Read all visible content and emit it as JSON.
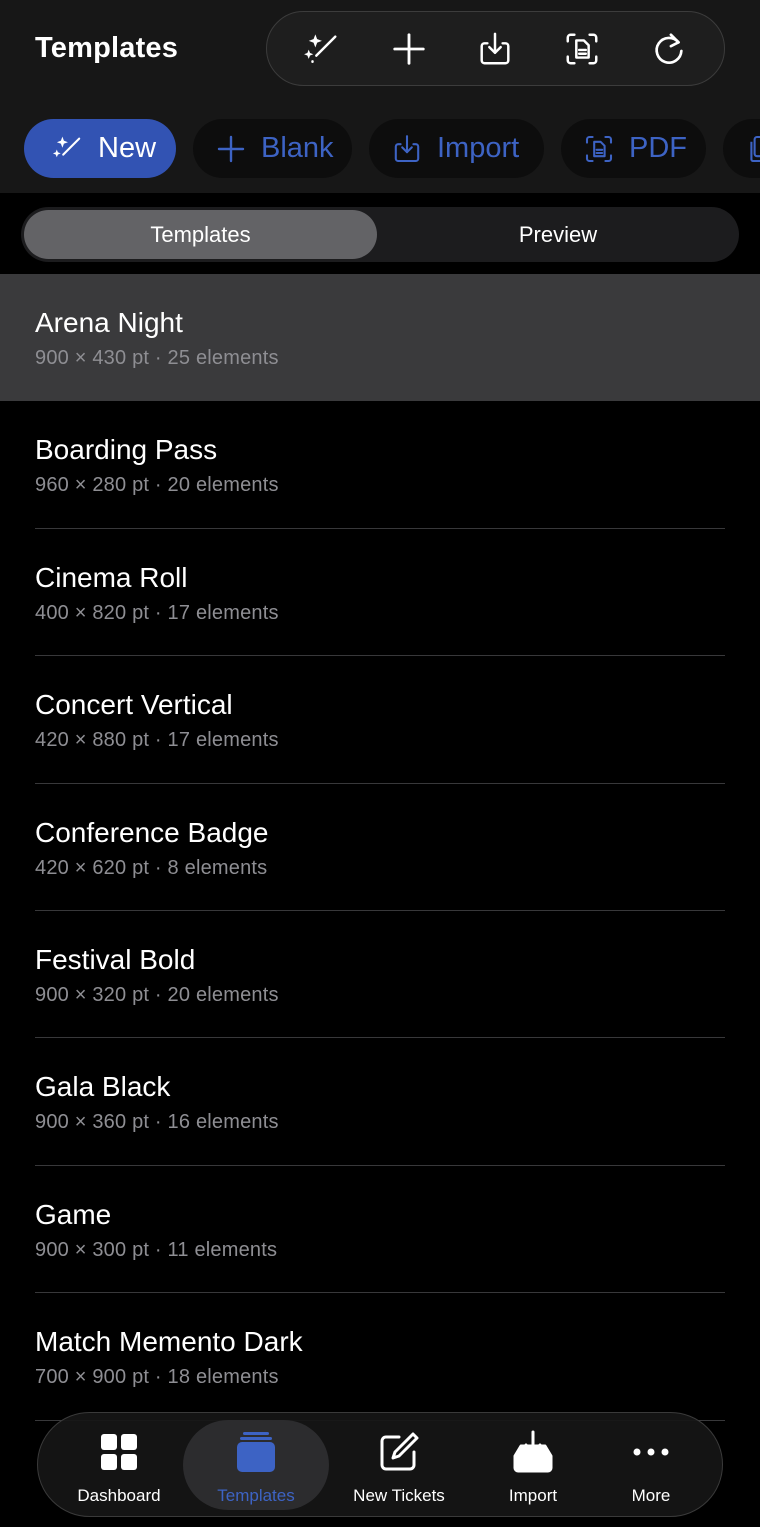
{
  "header": {
    "title": "Templates",
    "toolbar": [
      {
        "icon": "magic-wand-icon"
      },
      {
        "icon": "plus-icon"
      },
      {
        "icon": "import-tray-icon"
      },
      {
        "icon": "scan-document-icon"
      },
      {
        "icon": "refresh-icon"
      }
    ]
  },
  "chips": [
    {
      "label": "New",
      "icon": "magic-wand-icon"
    },
    {
      "label": "Blank",
      "icon": "plus-icon"
    },
    {
      "label": "Import",
      "icon": "import-tray-icon"
    },
    {
      "label": "PDF",
      "icon": "scan-document-icon"
    }
  ],
  "segment": {
    "templates_label": "Templates",
    "preview_label": "Preview",
    "selected": "Templates"
  },
  "templates": [
    {
      "name": "Arena Night",
      "meta": "900 × 430 pt · 25 elements"
    },
    {
      "name": "Boarding Pass",
      "meta": "960 × 280 pt · 20 elements"
    },
    {
      "name": "Cinema Roll",
      "meta": "400 × 820 pt · 17 elements"
    },
    {
      "name": "Concert Vertical",
      "meta": "420 × 880 pt · 17 elements"
    },
    {
      "name": "Conference Badge",
      "meta": "420 × 620 pt · 8 elements"
    },
    {
      "name": "Festival Bold",
      "meta": "900 × 320 pt · 20 elements"
    },
    {
      "name": "Gala Black",
      "meta": "900 × 360 pt · 16 elements"
    },
    {
      "name": "Game",
      "meta": "900 × 300 pt · 11 elements"
    },
    {
      "name": "Match Memento Dark",
      "meta": "700 × 900 pt · 18 elements"
    }
  ],
  "tabbar": {
    "dashboard": "Dashboard",
    "templates": "Templates",
    "new_tickets": "New Tickets",
    "import": "Import",
    "more": "More",
    "active": "Templates"
  },
  "colors": {
    "accent": "#3d63c4",
    "primary_chip": "#3253b3",
    "selected_row": "#3a3a3c"
  }
}
